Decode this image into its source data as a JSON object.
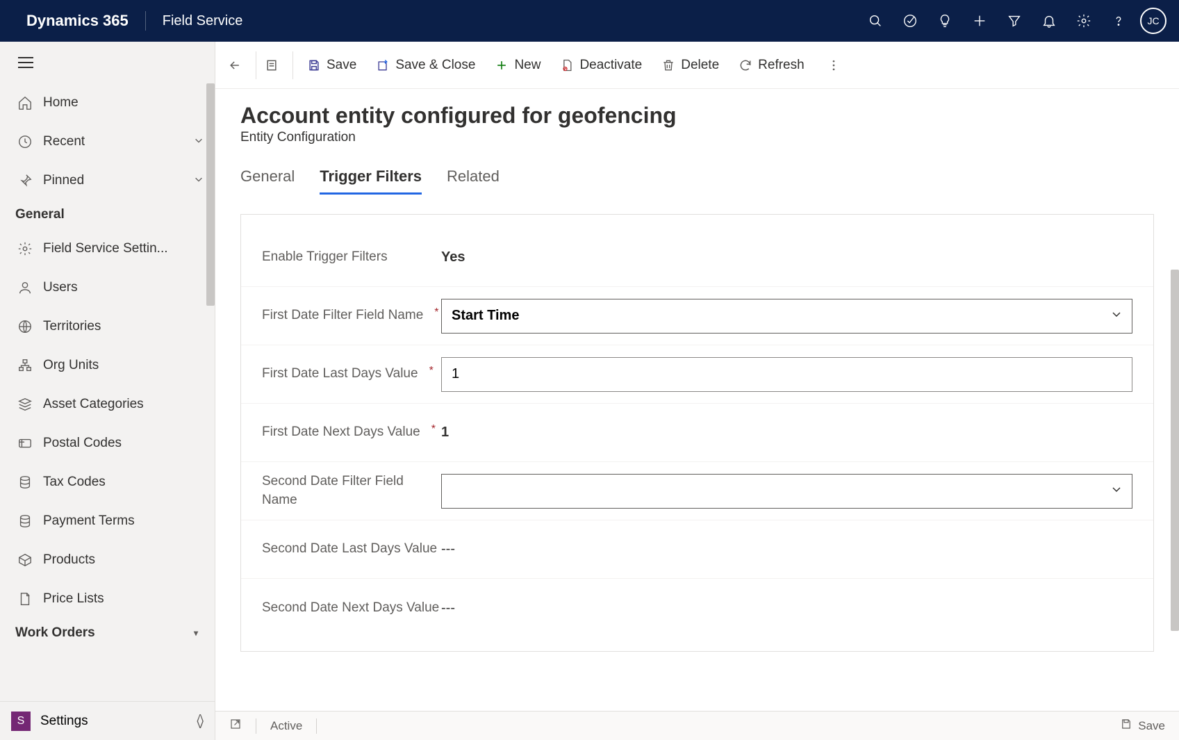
{
  "header": {
    "brand": "Dynamics 365",
    "app": "Field Service",
    "avatar_initials": "JC"
  },
  "sidebar": {
    "home": "Home",
    "recent": "Recent",
    "pinned": "Pinned",
    "section_general": "General",
    "items": [
      "Field Service Settin...",
      "Users",
      "Territories",
      "Org Units",
      "Asset Categories",
      "Postal Codes",
      "Tax Codes",
      "Payment Terms",
      "Products",
      "Price Lists"
    ],
    "section_workorders": "Work Orders",
    "area": {
      "badge": "S",
      "label": "Settings"
    }
  },
  "commands": {
    "save": "Save",
    "save_close": "Save & Close",
    "new": "New",
    "deactivate": "Deactivate",
    "delete": "Delete",
    "refresh": "Refresh"
  },
  "page": {
    "title": "Account entity configured for geofencing",
    "subtitle": "Entity Configuration"
  },
  "tabs": {
    "general": "General",
    "trigger": "Trigger Filters",
    "related": "Related"
  },
  "form": {
    "enable_label": "Enable Trigger Filters",
    "enable_value": "Yes",
    "first_field_label": "First Date Filter Field Name",
    "first_field_value": "Start Time",
    "first_last_label": "First Date Last Days Value",
    "first_last_value": "1",
    "first_next_label": "First Date Next Days Value",
    "first_next_value": "1",
    "second_field_label": "Second Date Filter Field Name",
    "second_field_value": "",
    "second_last_label": "Second Date Last Days Value",
    "second_last_value": "---",
    "second_next_label": "Second Date Next Days Value",
    "second_next_value": "---"
  },
  "status": {
    "state": "Active",
    "save": "Save"
  }
}
